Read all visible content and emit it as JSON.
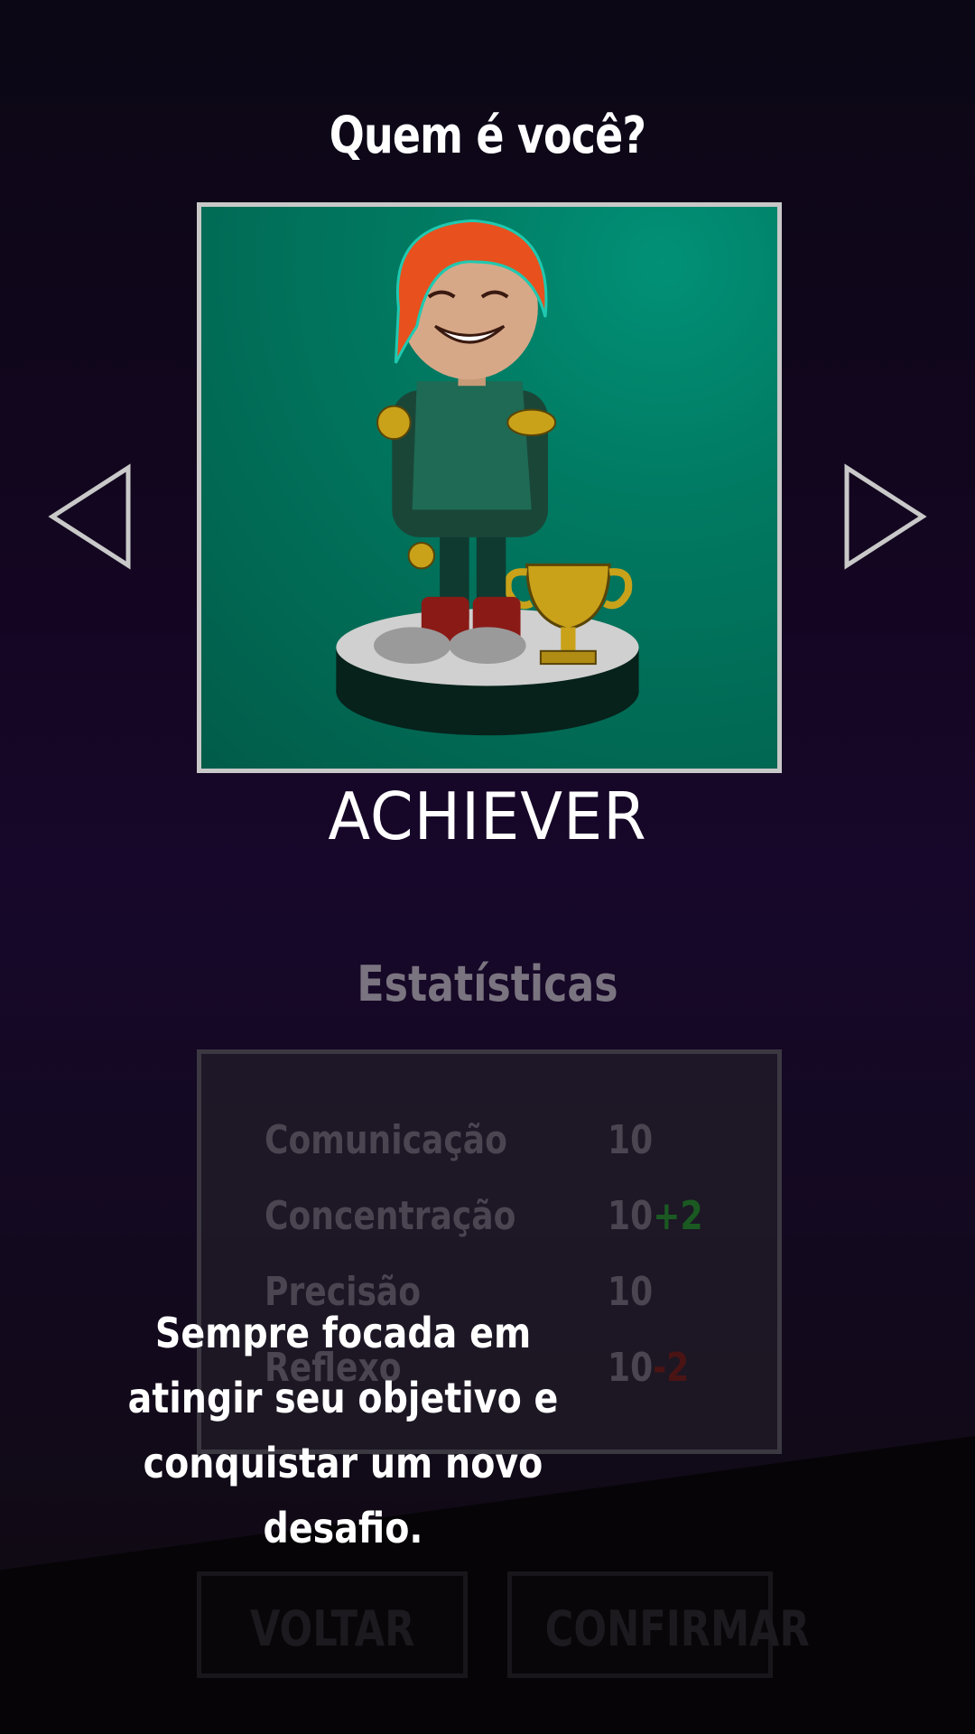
{
  "header": {
    "title": "Quem é você?"
  },
  "character": {
    "name": "ACHIEVER",
    "description": "Sempre focada em atingir seu objetivo e conquistar um novo desafio.",
    "portrait_bg": "#017a62",
    "hair_color": "#e8501e"
  },
  "navigation": {
    "prev_icon": "triangle-left-icon",
    "next_icon": "triangle-right-icon"
  },
  "stats": {
    "title": "Estatísticas",
    "rows": [
      {
        "name": "Comunicação",
        "value": "10",
        "modifier": ""
      },
      {
        "name": "Concentração",
        "value": "10",
        "modifier": "+2"
      },
      {
        "name": "Precisão",
        "value": "10",
        "modifier": ""
      },
      {
        "name": "Reflexo",
        "value": "10",
        "modifier": "-2"
      }
    ]
  },
  "buttons": {
    "back_label": "VOLTAR",
    "confirm_label": "CONFIRMAR"
  },
  "colors": {
    "background": "#130620",
    "frame": "#c8c8c8",
    "positive_modifier": "#1a5a22",
    "negative_modifier": "#4a1414"
  }
}
